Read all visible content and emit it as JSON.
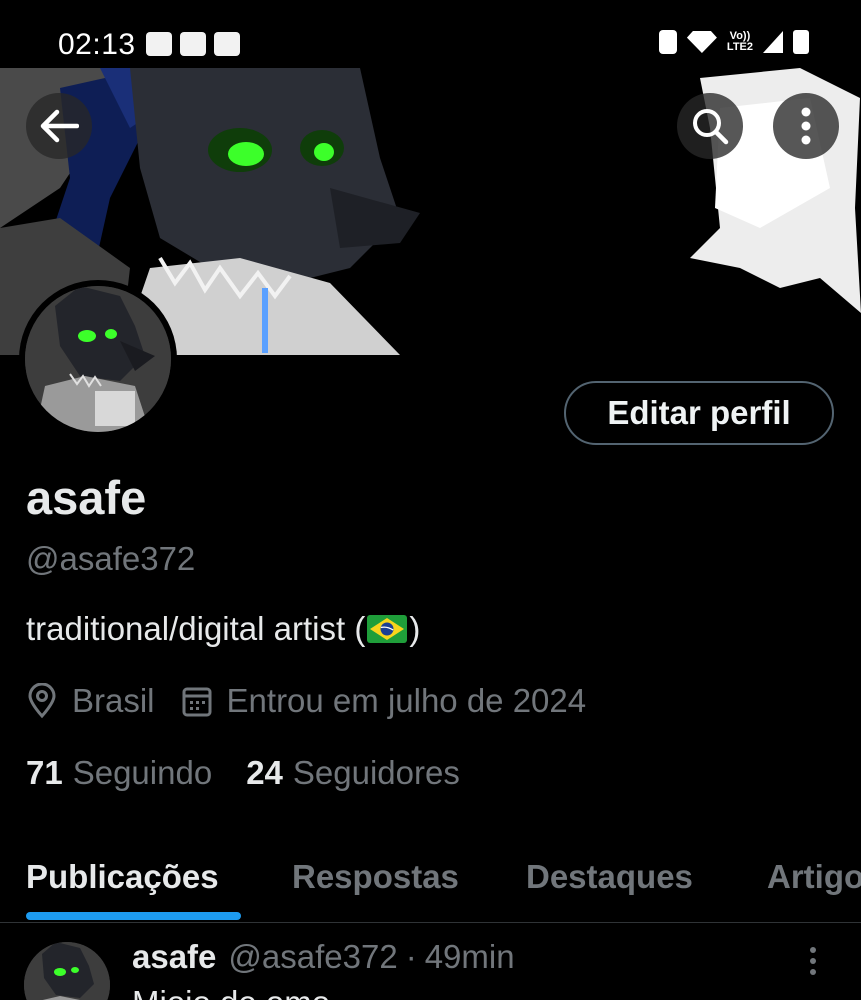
{
  "status_bar": {
    "time": "02:13",
    "network_label": "Vo))\nLTE2",
    "left_icons": [
      "game-controller-icon",
      "cinema-icon",
      "voicemail-icon"
    ],
    "right_icons": [
      "recycle-icon",
      "wifi-icon",
      "volte-icon",
      "signal-icon",
      "battery-icon"
    ]
  },
  "header": {
    "back_icon": "arrow-left-icon",
    "search_icon": "search-icon",
    "more_icon": "more-vertical-icon"
  },
  "profile": {
    "edit_button": "Editar perfil",
    "display_name": "asafe",
    "handle": "@asafe372",
    "bio_text_before": "traditional/digital artist (",
    "bio_text_after": ")",
    "location": "Brasil",
    "joined": "Entrou em julho de 2024",
    "following_count": "71",
    "following_label": "Seguindo",
    "followers_count": "24",
    "followers_label": "Seguidores"
  },
  "tabs": [
    {
      "label": "Publicações",
      "active": true
    },
    {
      "label": "Respostas",
      "active": false
    },
    {
      "label": "Destaques",
      "active": false
    },
    {
      "label": "Artigos",
      "active": false
    }
  ],
  "post": {
    "name": "asafe",
    "handle": "@asafe372",
    "dot": "·",
    "time": "49min",
    "text": "Mioio de omo"
  },
  "colors": {
    "background": "#000000",
    "primary_text": "#e7e9ea",
    "secondary_text": "#71767b",
    "accent": "#1d9bf0",
    "border": "#536471",
    "eye_glow": "#3cff2a"
  }
}
